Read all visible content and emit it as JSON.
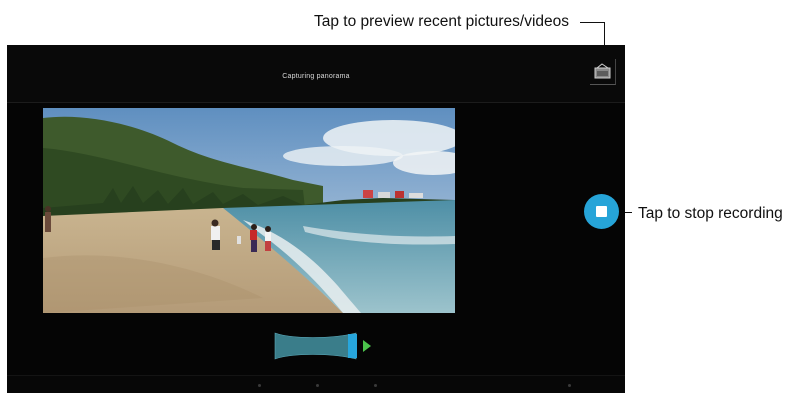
{
  "annotations": {
    "preview_hint": "Tap to preview recent pictures/videos",
    "stop_hint": "Tap to stop recording"
  },
  "camera": {
    "status_title": "Capturing panorama",
    "gallery_icon": "gallery-thumbnail-icon",
    "stop_icon": "stop-square-icon",
    "progress_indicator": "panorama-progress-icon"
  },
  "colors": {
    "accent": "#26a4d8",
    "progress_arrow": "#4cc44c",
    "screen_background": "#050505"
  }
}
